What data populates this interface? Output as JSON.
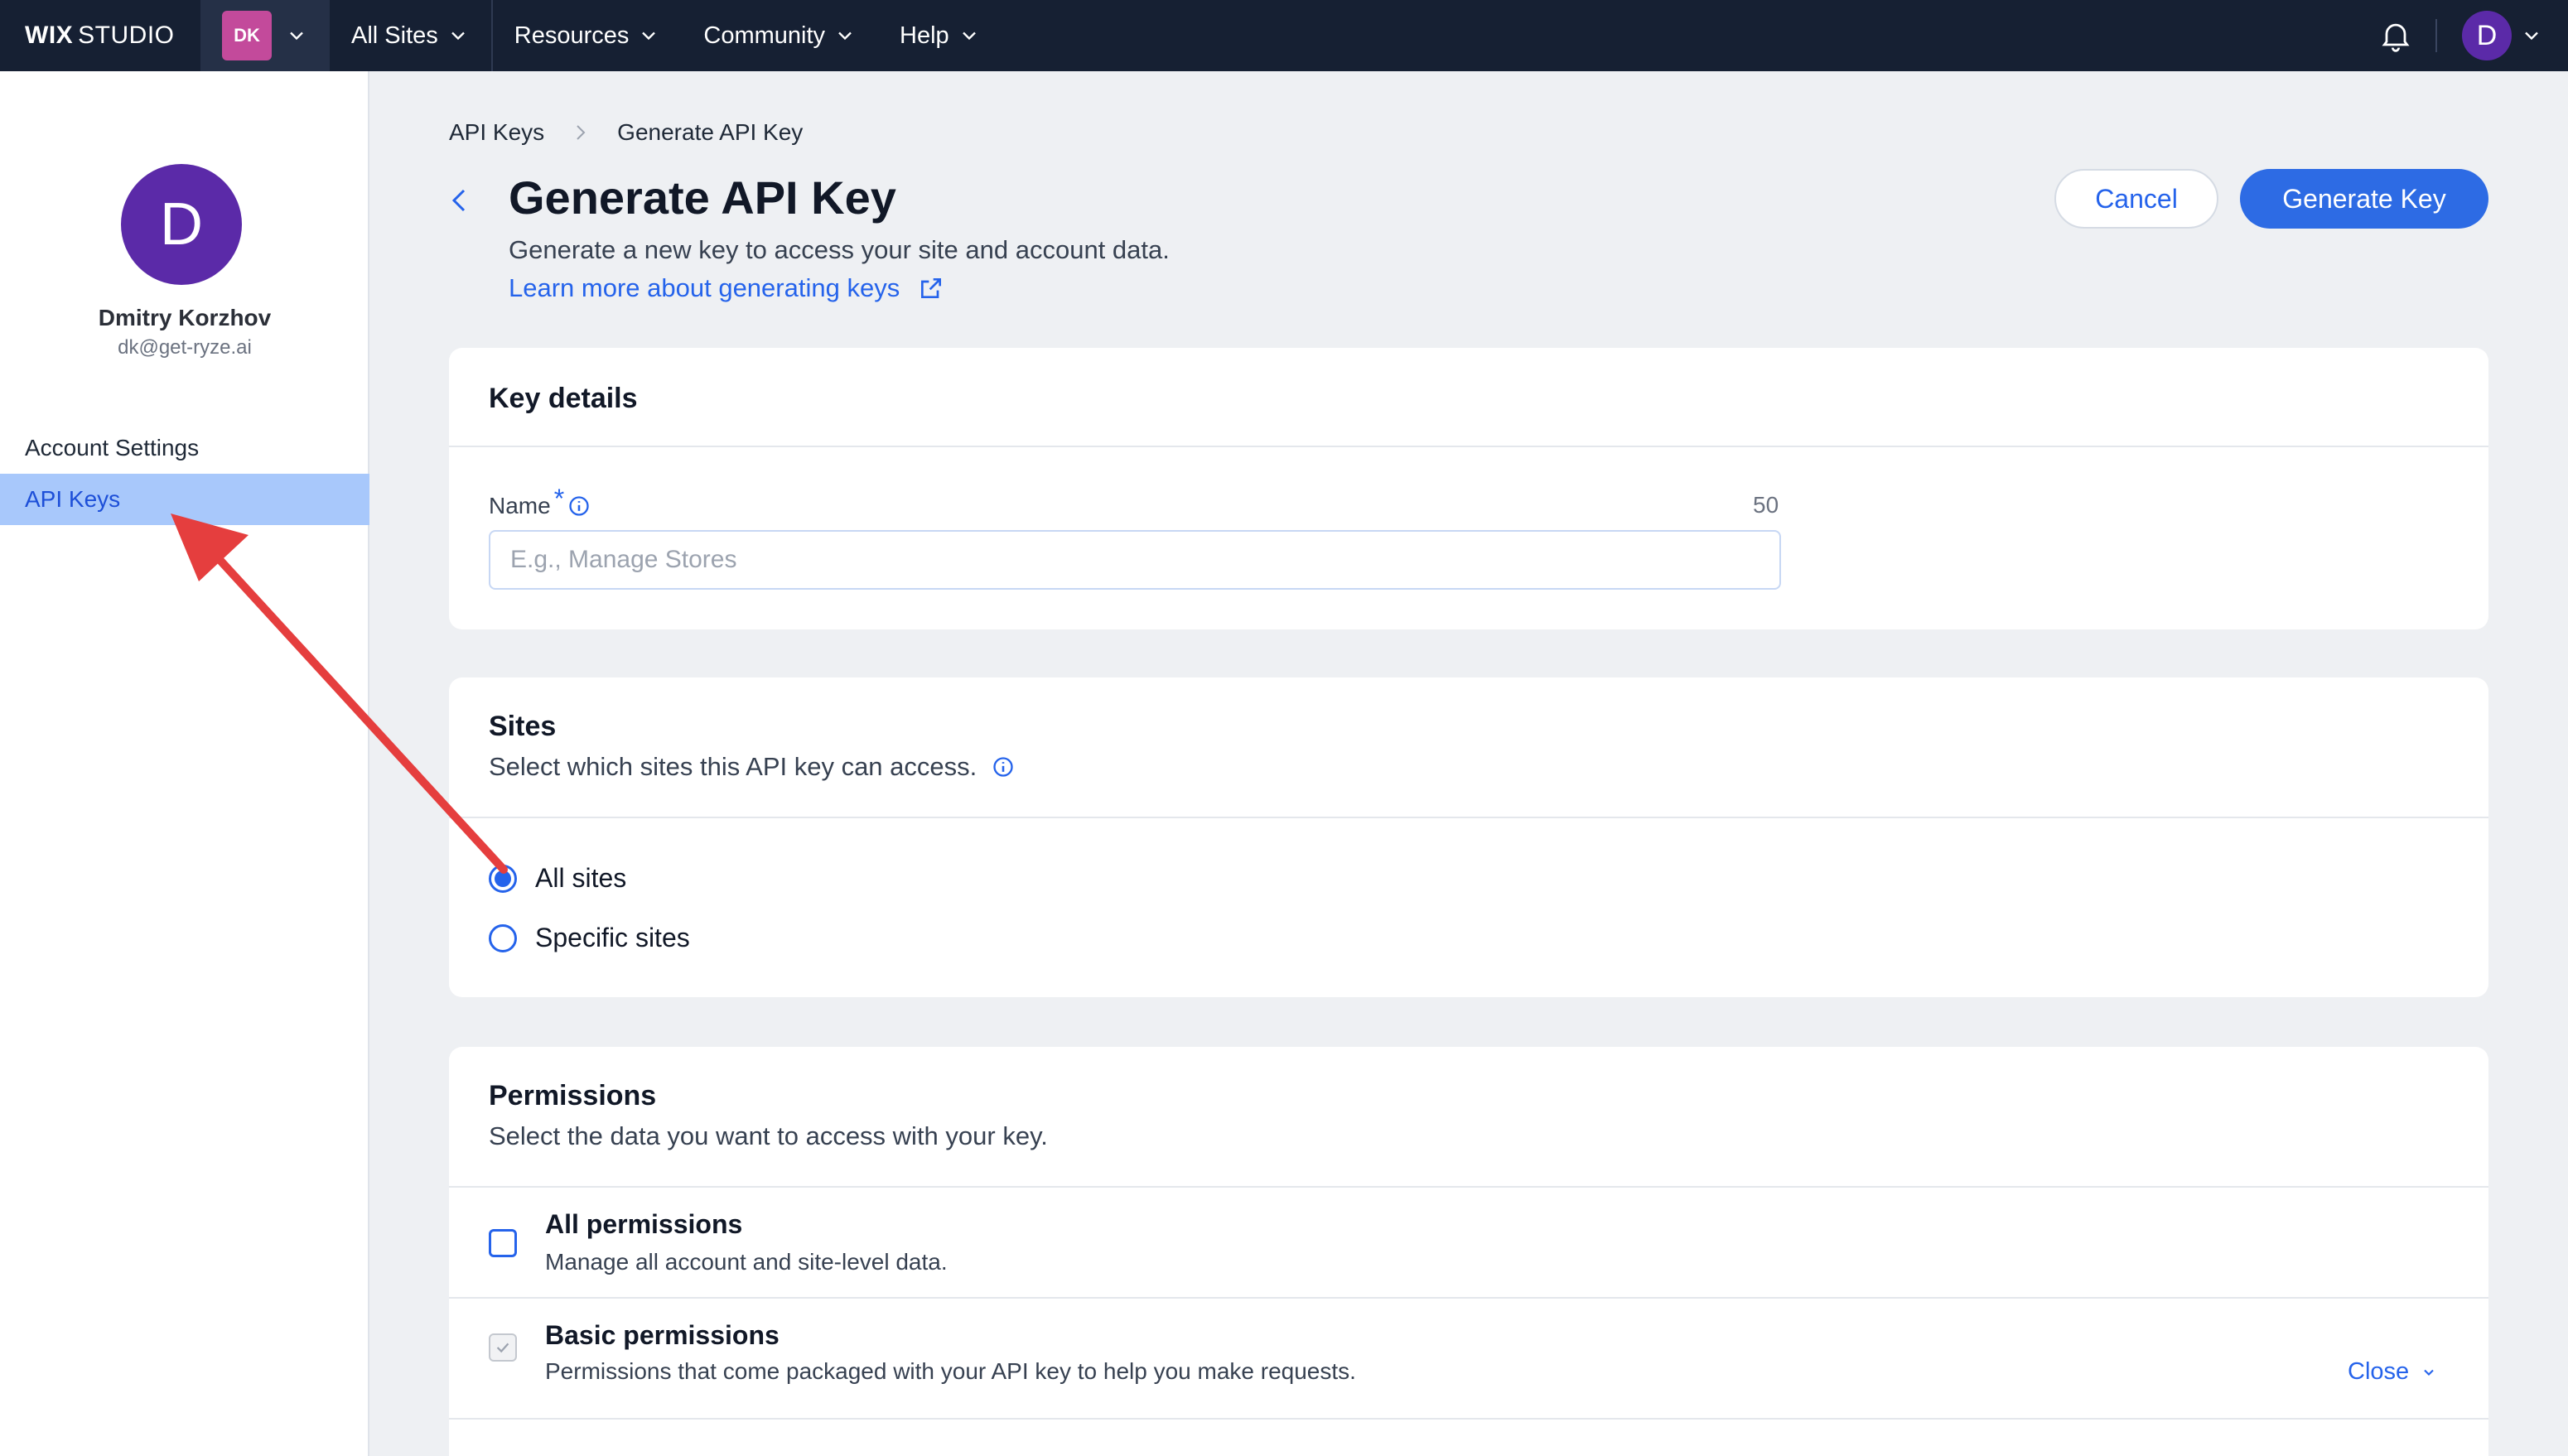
{
  "topbar": {
    "logo_bold": "WIX",
    "logo_rest": "STUDIO",
    "workspace_initials": "DK",
    "nav": [
      "All Sites",
      "Resources",
      "Community",
      "Help"
    ],
    "user_initial": "D"
  },
  "sidebar": {
    "avatar_initial": "D",
    "name": "Dmitry Korzhov",
    "email": "dk@get-ryze.ai",
    "items": [
      {
        "label": "Account Settings",
        "active": false
      },
      {
        "label": "API Keys",
        "active": true
      }
    ]
  },
  "breadcrumb": [
    "API Keys",
    "Generate API Key"
  ],
  "page": {
    "title": "Generate API Key",
    "subtitle": "Generate a new key to access your site and account data.",
    "learn_more": "Learn more about generating keys"
  },
  "actions": {
    "cancel": "Cancel",
    "generate": "Generate Key"
  },
  "key_details": {
    "title": "Key details",
    "name_label": "Name",
    "required_mark": "*",
    "char_limit": "50",
    "name_placeholder": "E.g., Manage Stores",
    "name_value": ""
  },
  "sites": {
    "title": "Sites",
    "subtitle": "Select which sites this API key can access.",
    "options": [
      {
        "label": "All sites",
        "checked": true
      },
      {
        "label": "Specific sites",
        "checked": false
      }
    ]
  },
  "permissions": {
    "title": "Permissions",
    "subtitle": "Select the data you want to access with your key.",
    "items": [
      {
        "title": "All permissions",
        "desc": "Manage all account and site-level data.",
        "checked": false
      },
      {
        "title": "Basic permissions",
        "desc": "Permissions that come packaged with your API key to help you make requests.",
        "checked": true,
        "disabled": true,
        "toggle": "Close"
      }
    ]
  },
  "colors": {
    "topbar": "#162033",
    "accent": "#2563eb",
    "primary_button": "#2d6be4",
    "active_nav": "#a8c8fb",
    "avatar": "#5b2aa8",
    "annotation_arrow": "#e53e3e"
  }
}
